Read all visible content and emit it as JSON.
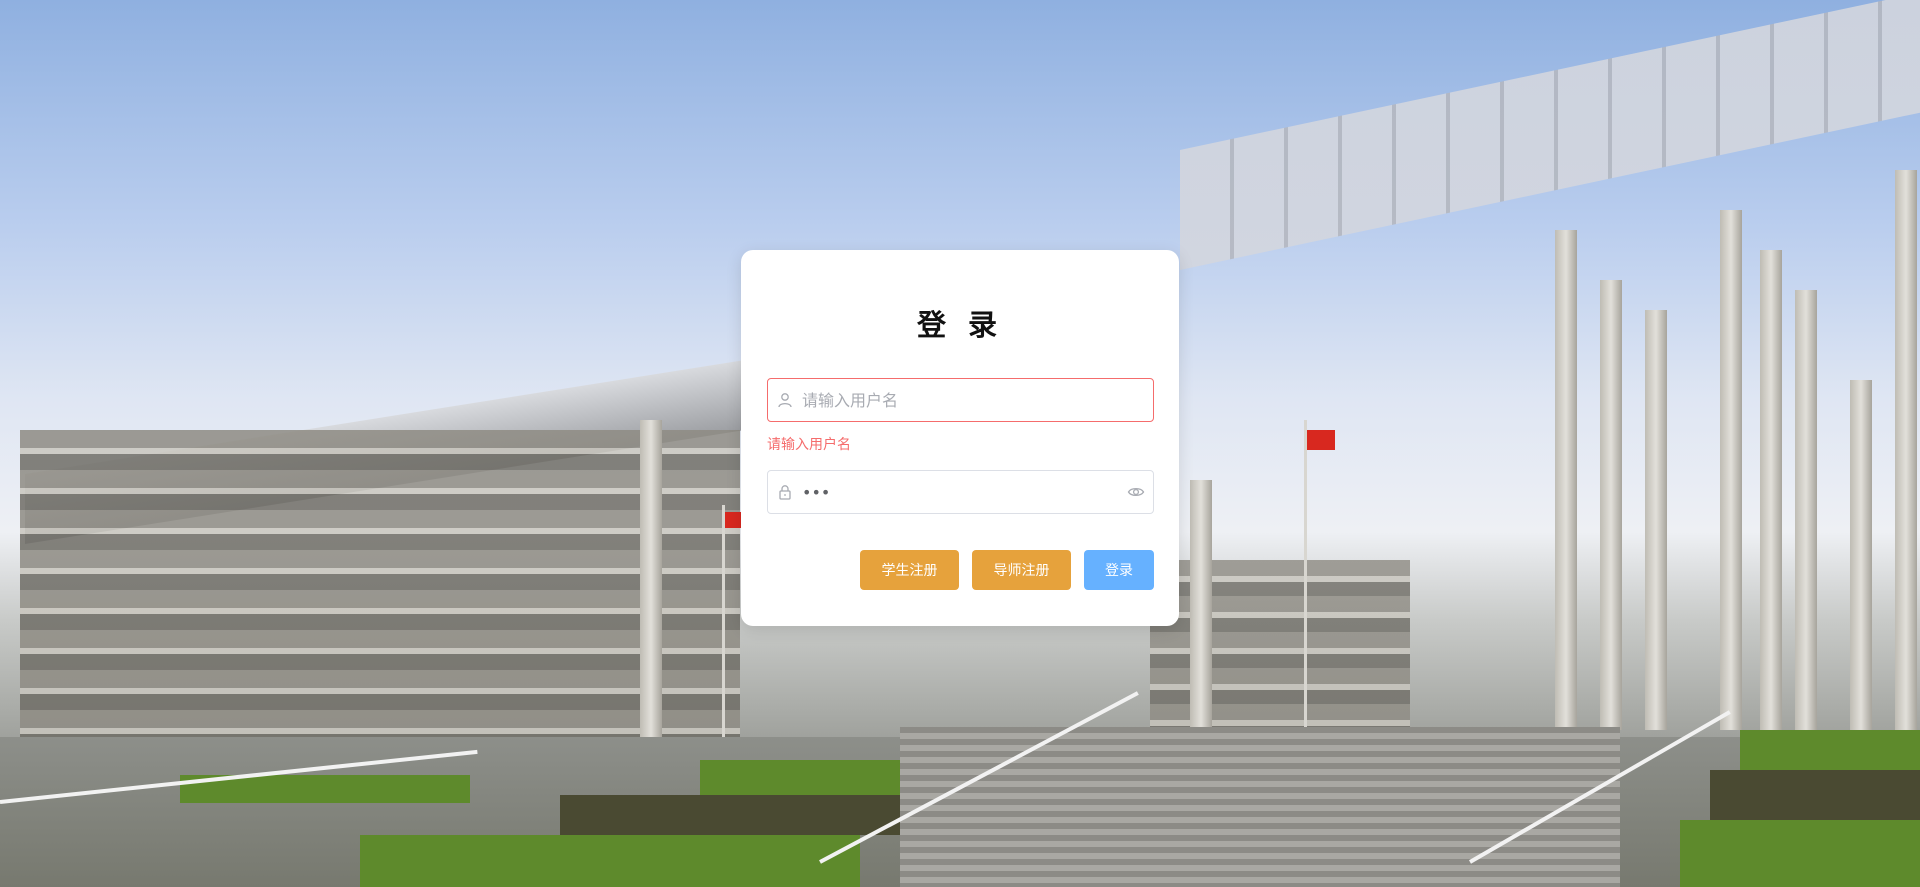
{
  "login": {
    "title": "登 录",
    "username": {
      "placeholder": "请输入用户名",
      "value": "",
      "error": "请输入用户名",
      "icon": "user-icon"
    },
    "password": {
      "value": "•••",
      "icon": "lock-icon",
      "toggle_icon": "eye-icon"
    },
    "buttons": {
      "student_register": "学生注册",
      "teacher_register": "导师注册",
      "login": "登录"
    }
  },
  "colors": {
    "error": "#f56c6c",
    "warning_button": "#e6a23c",
    "primary_button": "#66b1ff"
  }
}
